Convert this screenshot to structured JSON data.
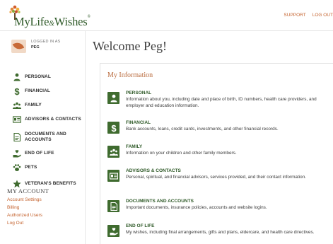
{
  "brand": {
    "name_part1": "MyLife",
    "amp": "&",
    "name_part2": "Wishes",
    "tm": "®"
  },
  "header_links": {
    "support": "SUPPORT",
    "logout": "LOG OUT"
  },
  "user": {
    "logged_in_label": "LOGGED IN AS",
    "name": "PEG"
  },
  "sidebar": {
    "items": [
      {
        "label": "PERSONAL",
        "icon": "person-icon"
      },
      {
        "label": "FINANCIAL",
        "icon": "dollar-icon"
      },
      {
        "label": "FAMILY",
        "icon": "family-icon"
      },
      {
        "label": "ADVISORS & CONTACTS",
        "icon": "contact-card-icon"
      },
      {
        "label": "DOCUMENTS AND ACCOUNTS",
        "icon": "document-icon"
      },
      {
        "label": "END OF LIFE",
        "icon": "hand-heart-icon"
      },
      {
        "label": "PETS",
        "icon": "paw-icon"
      },
      {
        "label": "VETERAN'S BENEFITS",
        "icon": "star-icon"
      }
    ]
  },
  "account": {
    "title": "MY ACCOUNT",
    "links": [
      "Account Settings",
      "Billing",
      "Authorized Users",
      "Log Out"
    ]
  },
  "main": {
    "welcome": "Welcome Peg!",
    "panel_title": "My Information",
    "rows": [
      {
        "title": "PERSONAL",
        "desc": "Information about you, including date and place of birth, ID numbers, health care providers, and employer and education information.",
        "icon": "person-icon"
      },
      {
        "title": "FINANCIAL",
        "desc": "Bank accounts, loans, credit cards, investments, and other financial records.",
        "icon": "dollar-icon"
      },
      {
        "title": "FAMILY",
        "desc": "Information on your children and other family members.",
        "icon": "family-icon"
      },
      {
        "title": "ADVISORS & CONTACTS",
        "desc": "Personal, spiritual, and financial advisors, services provided, and their contact information.",
        "icon": "contact-card-icon"
      },
      {
        "title": "DOCUMENTS AND ACCOUNTS",
        "desc": "Important documents, insurance policies, accounts and website logins.",
        "icon": "document-icon"
      },
      {
        "title": "END OF LIFE",
        "desc": "My wishes, including final arrangements, gifts and plans, eldercare, and health care directives.",
        "icon": "hand-heart-icon"
      }
    ]
  },
  "colors": {
    "green": "#3f6b2f",
    "accent": "#c4622d",
    "title_green": "#2f5a28"
  }
}
